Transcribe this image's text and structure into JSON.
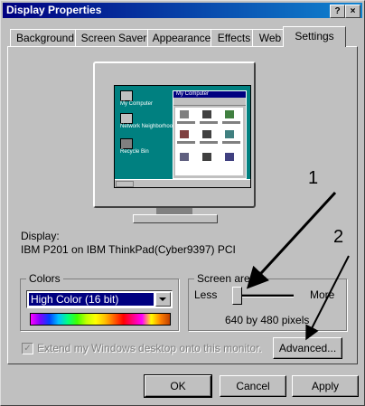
{
  "window": {
    "title": "Display Properties",
    "help_button": "?",
    "close_button": "×"
  },
  "tabs": [
    {
      "label": "Background"
    },
    {
      "label": "Screen Saver"
    },
    {
      "label": "Appearance"
    },
    {
      "label": "Effects"
    },
    {
      "label": "Web"
    },
    {
      "label": "Settings"
    }
  ],
  "active_tab": "Settings",
  "display": {
    "label": "Display:",
    "value": "IBM P201 on IBM ThinkPad(Cyber9397) PCI"
  },
  "colors": {
    "group_label": "Colors",
    "selected": "High Color (16 bit)"
  },
  "screen_area": {
    "group_label": "Screen area",
    "less_label": "Less",
    "more_label": "More",
    "resolution": "640 by 480 pixels",
    "slider_level": 0.0
  },
  "extend_checkbox": {
    "label": "Extend my Windows desktop onto this monitor.",
    "checked": true,
    "enabled": false
  },
  "buttons": {
    "advanced": "Advanced...",
    "ok": "OK",
    "cancel": "Cancel",
    "apply": "Apply"
  },
  "annotations": {
    "arrow1": "1",
    "arrow2": "2"
  },
  "preview": {
    "desktop_icons": [
      "My Computer",
      "Network Neighborhood",
      "Recycle Bin"
    ],
    "window_title": "My Computer"
  },
  "colors_palette": {
    "title_bar_start": "#000080",
    "title_bar_end": "#1084d0",
    "desktop": "#008080",
    "face": "#c0c0c0"
  }
}
